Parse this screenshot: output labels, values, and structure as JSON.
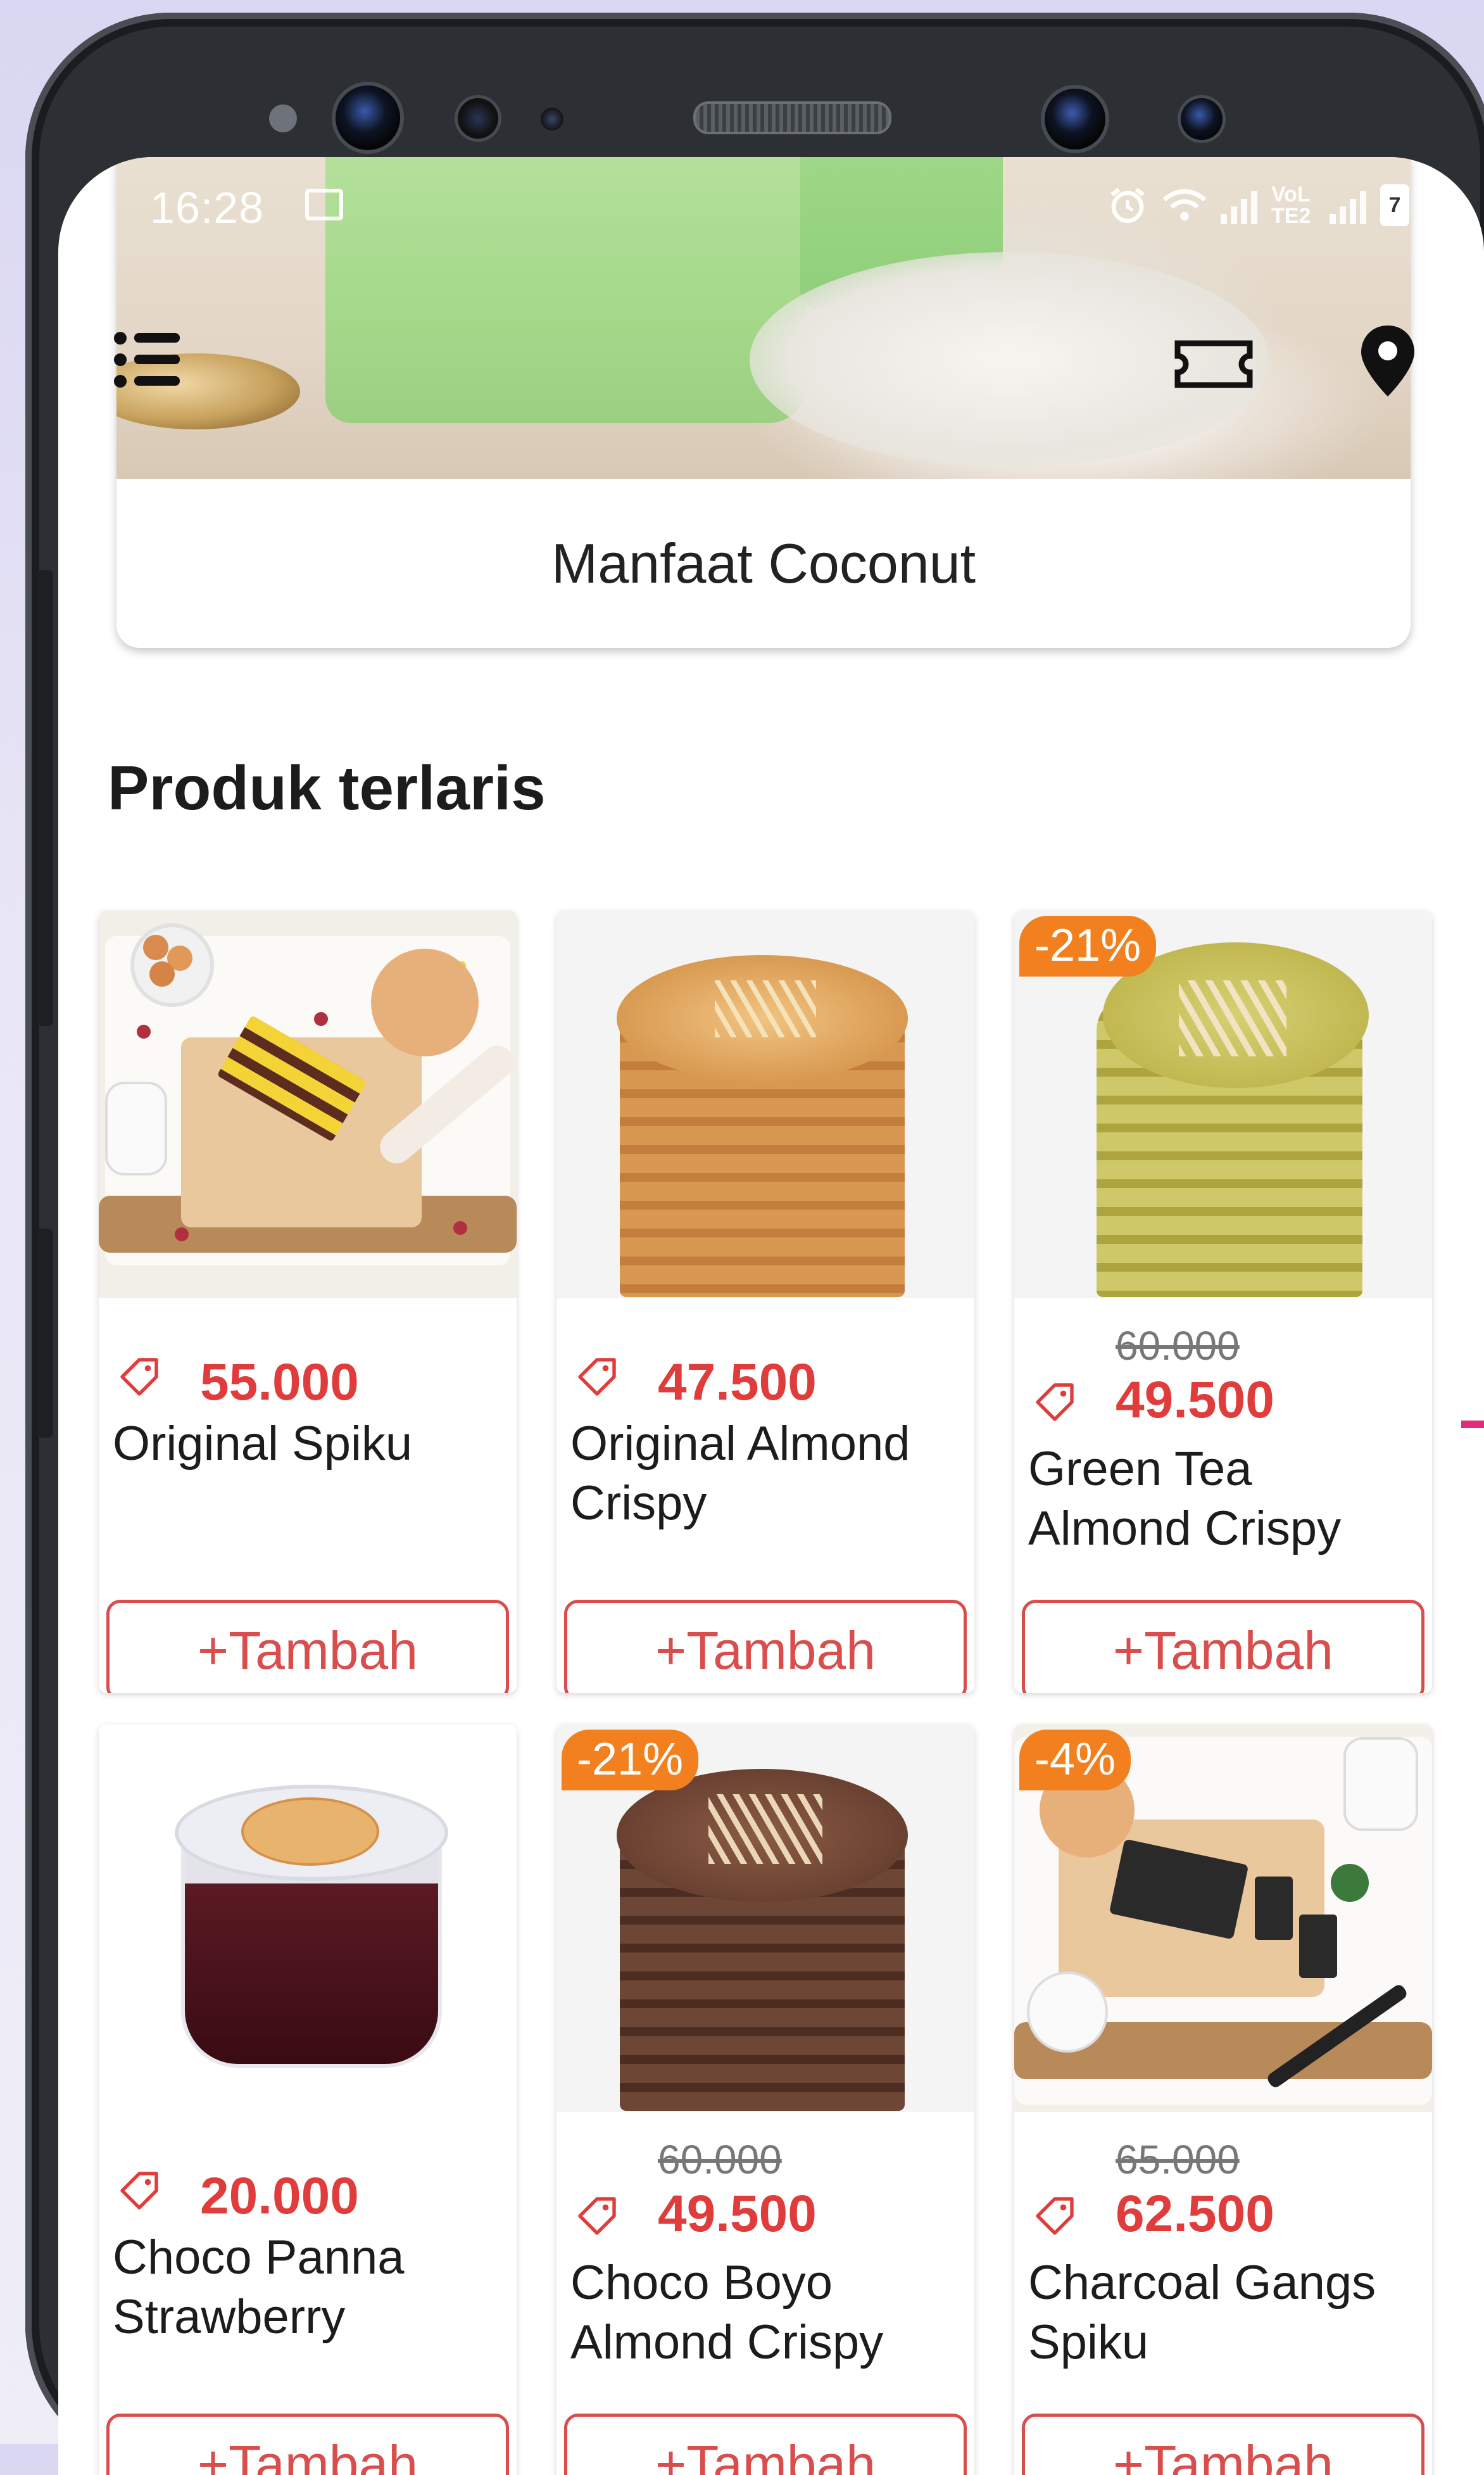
{
  "status_bar": {
    "time": "16:28",
    "network_label": "VoLTE2",
    "battery_level": "7"
  },
  "banner": {
    "title": "Manfaat Coconut"
  },
  "section": {
    "title": "Produk terlaris"
  },
  "products": [
    {
      "name": "Original Spiku",
      "price": "55.000",
      "old_price": "",
      "discount": "",
      "add_label": "+Tambah"
    },
    {
      "name": "Original Almond Crispy",
      "price": "47.500",
      "old_price": "",
      "discount": "",
      "add_label": "+Tambah"
    },
    {
      "name": "Green Tea Almond Crispy",
      "price": "49.500",
      "old_price": "60.000",
      "discount": "-21%",
      "add_label": "+Tambah"
    },
    {
      "name": "Choco Panna Strawberry",
      "price": "20.000",
      "old_price": "",
      "discount": "",
      "add_label": "+Tambah"
    },
    {
      "name": "Choco Boyo Almond Crispy",
      "price": "49.500",
      "old_price": "60.000",
      "discount": "-21%",
      "add_label": "+Tambah"
    },
    {
      "name": "Charcoal Gangs Spiku",
      "price": "62.500",
      "old_price": "65.000",
      "discount": "-4%",
      "add_label": "+Tambah"
    }
  ],
  "icons": {
    "menu": "menu-icon",
    "voucher": "ticket-icon",
    "location": "location-pin-icon",
    "price_tag": "price-tag-icon"
  },
  "colors": {
    "price": "#e03c3c",
    "button_border": "#d94d4d",
    "discount_badge": "#f3801e"
  }
}
